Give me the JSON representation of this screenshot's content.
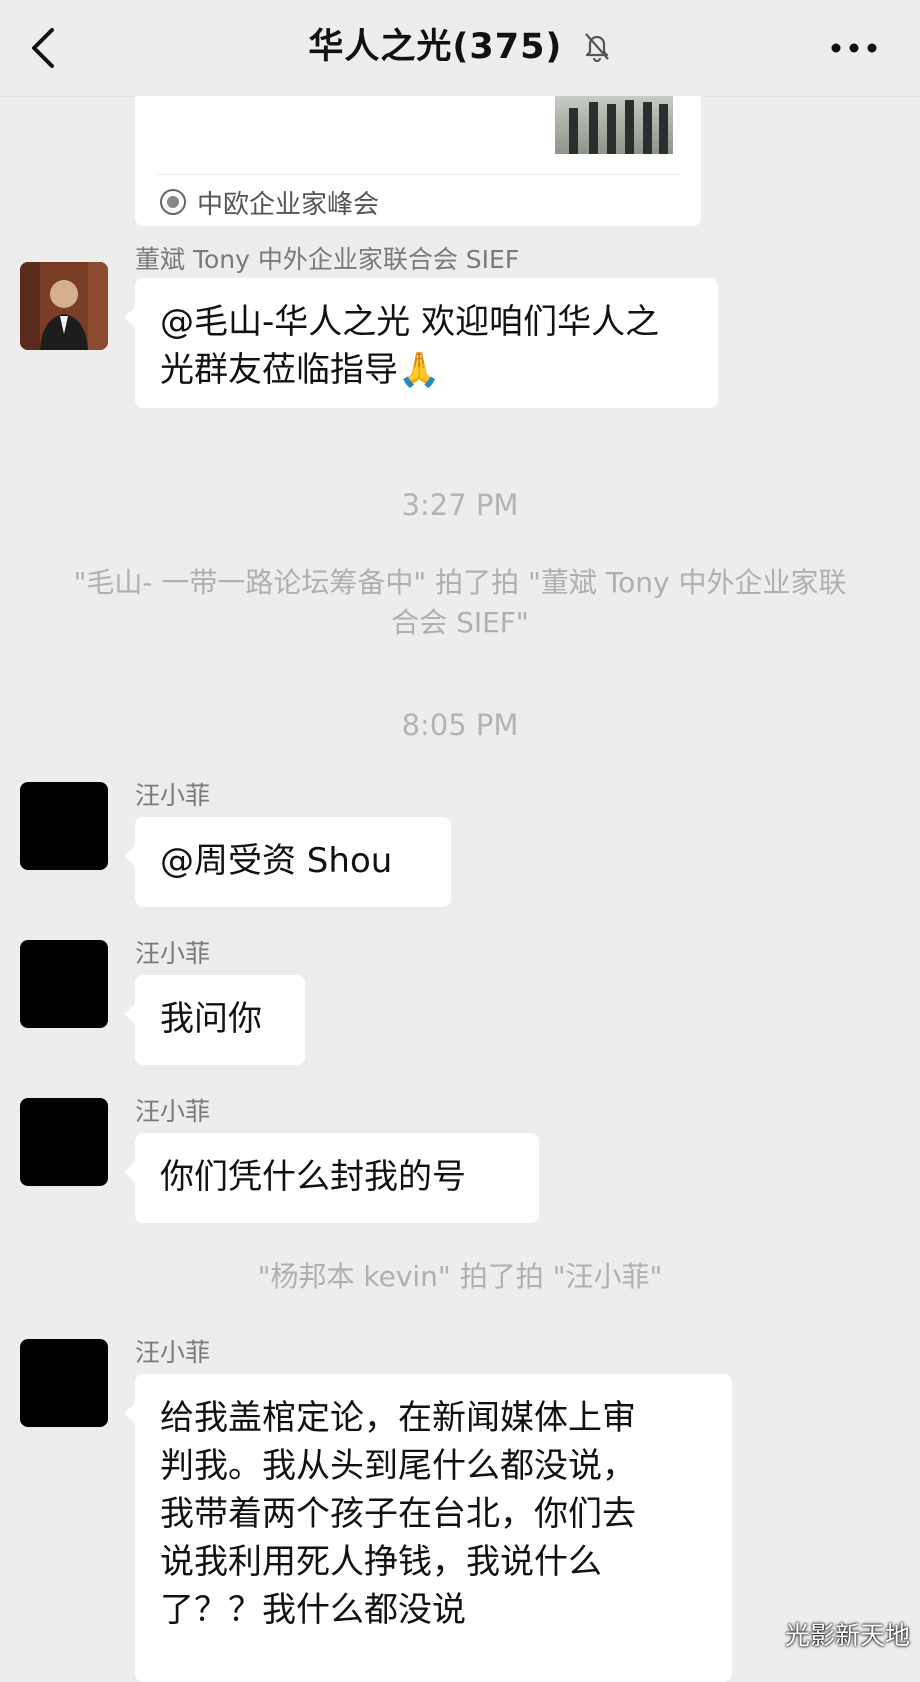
{
  "header": {
    "title": "华人之光(375)",
    "back_icon": "chevron-left-icon",
    "mute_icon": "bell-muted-icon",
    "more_icon": "more-dots-icon"
  },
  "link_card": {
    "source": "中欧企业家峰会"
  },
  "messages": [
    {
      "sender": "董斌 Tony 中外企业家联合会 SIEF",
      "text_line1": "@毛山-华人之光 欢迎咱们华人之",
      "text_line2": "光群友莅临指导",
      "emoji": "🙏"
    },
    {
      "timestamp": "3:27 PM"
    },
    {
      "system": "\"毛山- 一带一路论坛筹备中\" 拍了拍 \"董斌 Tony 中外企业家联合会 SIEF\""
    },
    {
      "timestamp": "8:05 PM"
    },
    {
      "sender": "汪小菲",
      "text": "@周受资 Shou"
    },
    {
      "sender": "汪小菲",
      "text": "我问你"
    },
    {
      "sender": "汪小菲",
      "text": "你们凭什么封我的号"
    },
    {
      "system": "\"杨邦本 kevin\" 拍了拍 \"汪小菲\""
    },
    {
      "sender": "汪小菲",
      "lines": [
        "给我盖棺定论，在新闻媒体上审",
        "判我。我从头到尾什么都没说，",
        "我带着两个孩子在台北，你们去",
        "说我利用死人挣钱，我说什么",
        "了？？我什么都没说"
      ]
    }
  ],
  "watermark": "光影新天地"
}
